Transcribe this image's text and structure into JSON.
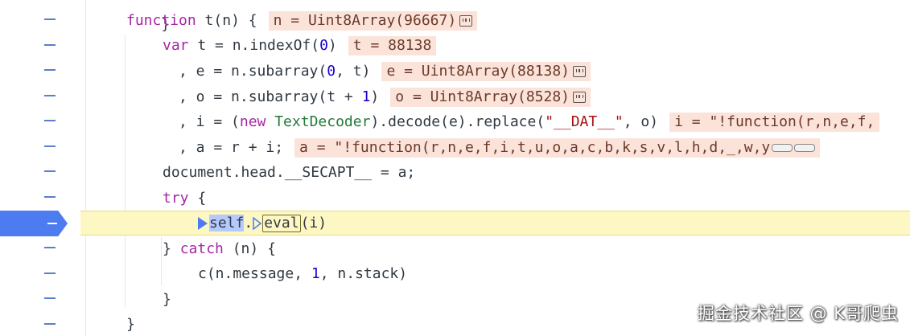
{
  "code": {
    "line_top": "}",
    "line_fn": {
      "kw": "function",
      "name": "t",
      "params": "(n)",
      "brace": "{",
      "val": "n = Uint8Array(96667)"
    },
    "line_var": {
      "kw": "var",
      "decl": "t = n.indexOf(",
      "num": "0",
      "close": ")",
      "val": "t = 88138"
    },
    "line_e": {
      "lead": ", e = n.subarray(",
      "n1": "0",
      "mid": ", t)",
      "val": "e = Uint8Array(88138)"
    },
    "line_o": {
      "lead": ", o = n.subarray(t + ",
      "n1": "1",
      "close": ")",
      "val": "o = Uint8Array(8528)"
    },
    "line_i": {
      "lead": ", i = (",
      "kw": "new",
      "cls": "TextDecoder",
      "mid": ").decode(e).replace(",
      "str": "\"__DAT__\"",
      "tail": ", o)",
      "val": "i = \"!function(r,n,e,f,"
    },
    "line_a": {
      "lead": ", a = r + i;",
      "val": "a = \"!function(r,n,e,f,i,t,u,o,a,c,b,k,s,v,l,h,d,_,w,y"
    },
    "line_doc": "document.head.__SECAPT__ = a;",
    "line_try": {
      "kw": "try",
      "brace": "{"
    },
    "line_eval": {
      "self": "self",
      "dot": ".",
      "eval": "eval",
      "args": "(i)"
    },
    "line_catch": {
      "close": "}",
      "kw": "catch",
      "params": "(n)",
      "brace": "{"
    },
    "line_c": {
      "lead": "c(n.message, ",
      "num": "1",
      "tail": ", n.stack)"
    },
    "line_close1": "}",
    "line_close2": "}"
  },
  "watermark": "掘金技术社区 @ K哥爬虫",
  "colors": {
    "keyword": "#a626a4",
    "class": "#237a3a",
    "string": "#aa1111",
    "number": "#1c00cf",
    "inline_value_bg": "#fbe3da",
    "highlight_bg": "#fdf7c3",
    "breakpoint": "#4d7cf0"
  },
  "icons": [
    "memory-inspector-icon",
    "breakpoint-marker",
    "step-arrow-icon"
  ]
}
